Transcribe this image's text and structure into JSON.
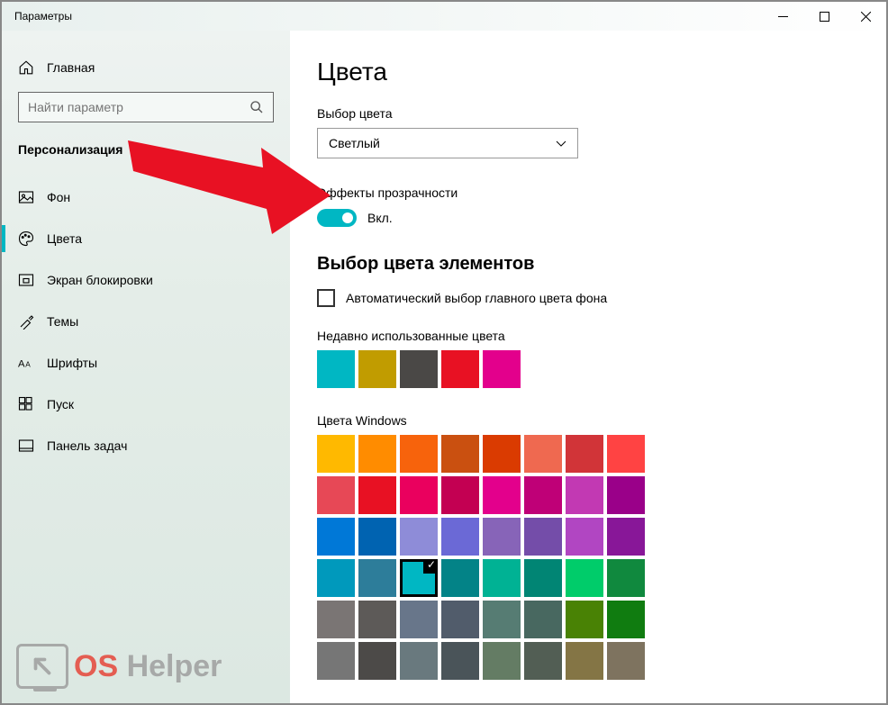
{
  "window": {
    "title": "Параметры"
  },
  "sidebar": {
    "home": "Главная",
    "search_placeholder": "Найти параметр",
    "section": "Персонализация",
    "items": [
      {
        "label": "Фон"
      },
      {
        "label": "Цвета"
      },
      {
        "label": "Экран блокировки"
      },
      {
        "label": "Темы"
      },
      {
        "label": "Шрифты"
      },
      {
        "label": "Пуск"
      },
      {
        "label": "Панель задач"
      }
    ]
  },
  "main": {
    "title": "Цвета",
    "color_mode_label": "Выбор цвета",
    "color_mode_value": "Светлый",
    "transparency_label": "Эффекты прозрачности",
    "transparency_state": "Вкл.",
    "accent_heading": "Выбор цвета элементов",
    "auto_pick_label": "Автоматический выбор главного цвета фона",
    "recent_label": "Недавно использованные цвета",
    "recent_colors": [
      "#00b7c3",
      "#c19c00",
      "#4a4846",
      "#e81123",
      "#e3008c"
    ],
    "windows_colors_label": "Цвета Windows",
    "windows_colors": [
      "#ffb900",
      "#ff8c00",
      "#f7630c",
      "#ca5010",
      "#da3b01",
      "#ef6950",
      "#d13438",
      "#ff4343",
      "#e74856",
      "#e81123",
      "#ea005e",
      "#c30052",
      "#e3008c",
      "#bf0077",
      "#c239b3",
      "#9a0089",
      "#0078d7",
      "#0063b1",
      "#8e8cd8",
      "#6b69d6",
      "#8764b8",
      "#744da9",
      "#b146c2",
      "#881798",
      "#0099bc",
      "#2d7d9a",
      "#00b7c3",
      "#038387",
      "#00b294",
      "#018574",
      "#00cc6a",
      "#10893e",
      "#7a7574",
      "#5d5a58",
      "#68768a",
      "#515c6b",
      "#567c73",
      "#486860",
      "#498205",
      "#107c10",
      "#767676",
      "#4c4a48",
      "#69797e",
      "#4a5459",
      "#647c64",
      "#525e54",
      "#847545",
      "#7e735f"
    ],
    "selected_color_index": 26
  },
  "watermark": {
    "os": "OS",
    "helper": " Helper"
  }
}
